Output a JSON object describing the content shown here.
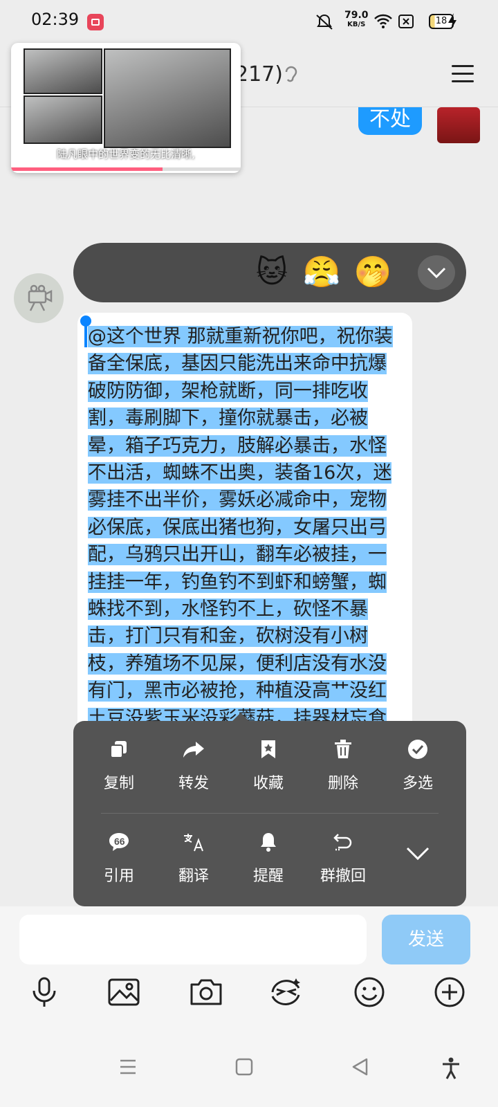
{
  "status_bar": {
    "time": "02:39",
    "speed_value": "79.0",
    "speed_unit": "KB/S",
    "battery": "18"
  },
  "header": {
    "title": "217)",
    "menu_icon": "hamburger-icon"
  },
  "video": {
    "caption": "陆凡眼中的世界变的无比清晰,",
    "progress": 0.66
  },
  "chat": {
    "right_bubble_text": "不处",
    "message_text": "@这个世界 那就重新祝你吧，祝你装备全保底，基因只能洗出来命中抗爆破防防御，架枪就断，同一排吃收割，毒刷脚下，撞你就暴击，必被晕，箱子巧克力，肢解必暴击，水怪不出活，蜘蛛不出奥，装备16次，迷雾挂不出半价，雾妖必减命中，宠物必保底，保底出猪也狗，女屠只出弓配，乌鸦只出开山，翻车必被挂，一挂挂一年，钓鱼钓不到虾和螃蟹，蜘蛛找不到，水怪钓不上，砍怪不暴击，打门只有和金，砍树没有小树枝，养殖场不见屎，便利店没有水没有门，黑市必被抢，种植没高艹没红土豆没紫玉米没彩蘑菇，挂器材忘食物"
  },
  "reactions": [
    "🐱",
    "😤",
    "🤭"
  ],
  "context_menu": {
    "row1": [
      "复制",
      "转发",
      "收藏",
      "删除",
      "多选"
    ],
    "row2": [
      "引用",
      "翻译",
      "提醒",
      "群撤回"
    ]
  },
  "input": {
    "send_label": "发送"
  },
  "colors": {
    "accent": "#1e9bff",
    "selection": "#84c9ff",
    "menu_bg": "#545454"
  }
}
